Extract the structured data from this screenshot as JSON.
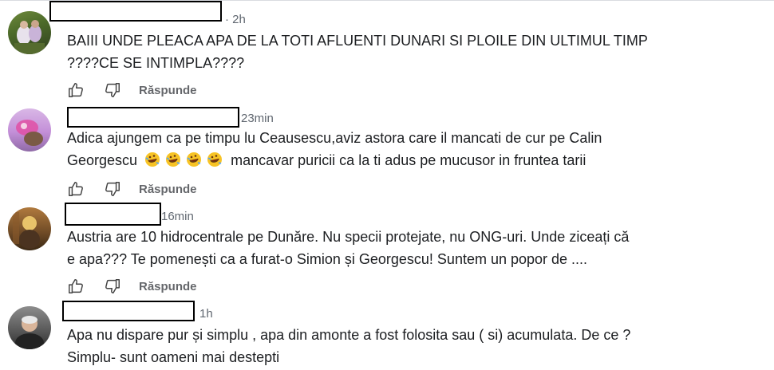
{
  "comments": [
    {
      "time": "· 2h",
      "text_lines": [
        "BAIII UNDE PLEACA APA DE LA TOTI AFLUENTI DUNARI SI PLOILE DIN ULTIMUL TIMP",
        "????CE SE INTIMPLA????"
      ],
      "reply_label": "Răspunde"
    },
    {
      "time": "23min",
      "text_lines": [
        "Adica ajungem ca pe timpu lu Ceausescu,aviz astora care il mancati de cur pe Calin"
      ],
      "line2_prefix": "Georgescu",
      "line2_suffix": "mancavar puricii ca la ti adus pe mucusor in fruntea tarii",
      "emoji_name": "rolling-on-floor-laughing-emoji",
      "reply_label": "Răspunde"
    },
    {
      "time": "16min",
      "text_lines": [
        "Austria are 10 hidrocentrale pe Dunăre. Nu specii protejate, nu ONG-uri. Unde ziceați că",
        "e apa??? Te pomenești ca a furat-o Simion și Georgescu! Suntem un popor de ...."
      ],
      "reply_label": "Răspunde"
    },
    {
      "time": "1h",
      "text_lines": [
        "Apa nu dispare pur și simplu , apa din amonte a fost folosita sau ( si) acumulata. De ce ?",
        "Simplu- sunt oameni mai destepti"
      ]
    }
  ],
  "icons": {
    "like": "thumbs-up-icon",
    "dislike": "thumbs-down-icon"
  }
}
